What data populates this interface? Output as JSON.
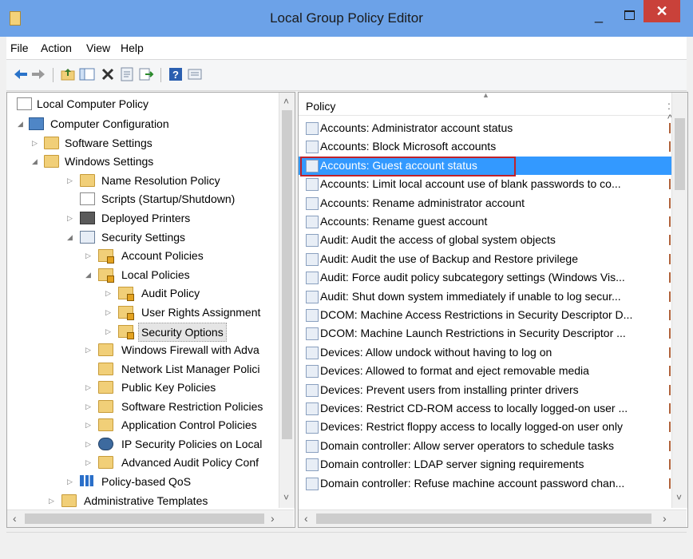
{
  "window": {
    "title": "Local Group Policy Editor",
    "minimize_glyph": "_",
    "close_glyph": "✕"
  },
  "menu": [
    "File",
    "Action",
    "View",
    "Help"
  ],
  "toolbar": {
    "icons": [
      "back-arrow-icon",
      "forward-arrow-icon",
      "up-folder-icon",
      "show-hide-tree-icon",
      "delete-icon",
      "properties-icon",
      "export-list-icon",
      "help-icon",
      "filter-options-icon"
    ]
  },
  "tree": {
    "items": [
      {
        "label": "Local Computer Policy"
      },
      {
        "label": "Computer Configuration"
      },
      {
        "label": "Software Settings"
      },
      {
        "label": "Windows Settings"
      },
      {
        "label": "Name Resolution Policy"
      },
      {
        "label": "Scripts (Startup/Shutdown)"
      },
      {
        "label": "Deployed Printers"
      },
      {
        "label": "Security Settings"
      },
      {
        "label": "Account Policies"
      },
      {
        "label": "Local Policies"
      },
      {
        "label": "Audit Policy"
      },
      {
        "label": "User Rights Assignment"
      },
      {
        "label": "Security Options"
      },
      {
        "label": "Windows Firewall with Adva"
      },
      {
        "label": "Network List Manager Polici"
      },
      {
        "label": "Public Key Policies"
      },
      {
        "label": "Software Restriction Policies"
      },
      {
        "label": "Application Control Policies"
      },
      {
        "label": "IP Security Policies on Local"
      },
      {
        "label": "Advanced Audit Policy Conf"
      },
      {
        "label": "Policy-based QoS"
      },
      {
        "label": "Administrative Templates"
      }
    ]
  },
  "list": {
    "column_header": "Policy",
    "selected_index": 2,
    "rows": [
      "Accounts: Administrator account status",
      "Accounts: Block Microsoft accounts",
      "Accounts: Guest account status",
      "Accounts: Limit local account use of blank passwords to co...",
      "Accounts: Rename administrator account",
      "Accounts: Rename guest account",
      "Audit: Audit the access of global system objects",
      "Audit: Audit the use of Backup and Restore privilege",
      "Audit: Force audit policy subcategory settings (Windows Vis...",
      "Audit: Shut down system immediately if unable to log secur...",
      "DCOM: Machine Access Restrictions in Security Descriptor D...",
      "DCOM: Machine Launch Restrictions in Security Descriptor ...",
      "Devices: Allow undock without having to log on",
      "Devices: Allowed to format and eject removable media",
      "Devices: Prevent users from installing printer drivers",
      "Devices: Restrict CD-ROM access to locally logged-on user ...",
      "Devices: Restrict floppy access to locally logged-on user only",
      "Domain controller: Allow server operators to schedule tasks",
      "Domain controller: LDAP server signing requirements",
      "Domain controller: Refuse machine account password chan..."
    ]
  },
  "colors": {
    "titlebar": "#6ca2e8",
    "close_button": "#c9413a",
    "selection": "#3399ff",
    "highlight_box": "#c0222a"
  }
}
